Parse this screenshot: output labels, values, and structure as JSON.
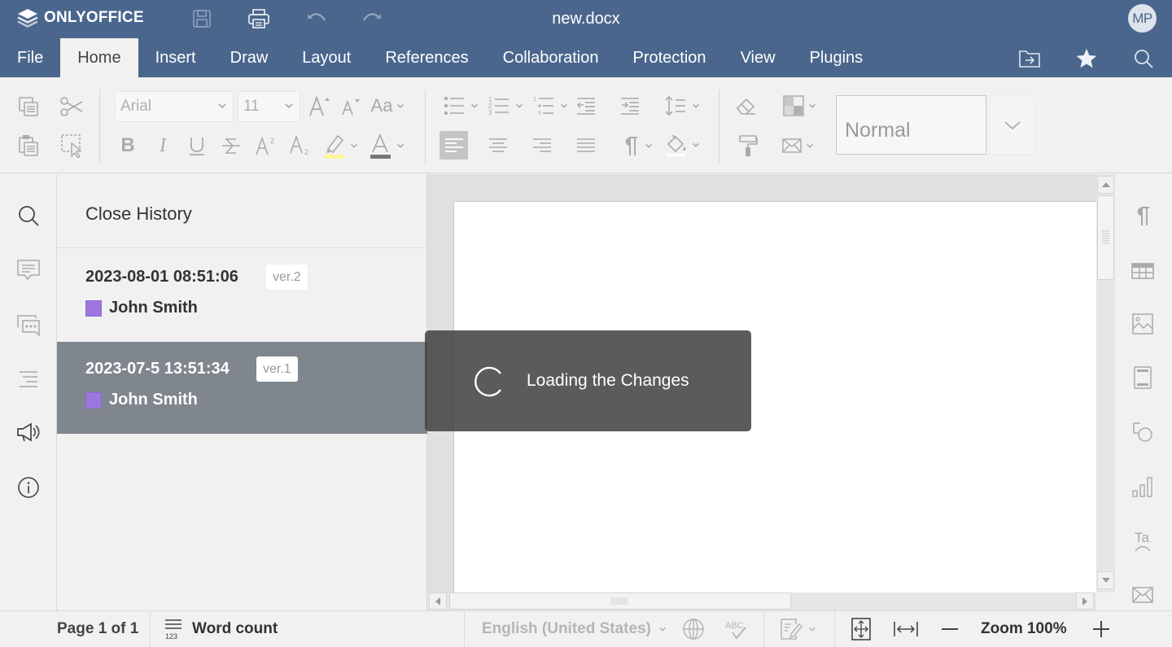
{
  "app": {
    "logo_text": "ONLYOFFICE",
    "document_title": "new.docx",
    "user_initials": "MP",
    "accent_color": "#4a668d"
  },
  "quick_access": [
    {
      "name": "save",
      "icon": "save-icon"
    },
    {
      "name": "print",
      "icon": "print-icon"
    },
    {
      "name": "undo",
      "icon": "undo-icon"
    },
    {
      "name": "redo",
      "icon": "redo-icon"
    }
  ],
  "tabs": [
    {
      "label": "File"
    },
    {
      "label": "Home",
      "active": true
    },
    {
      "label": "Insert"
    },
    {
      "label": "Draw"
    },
    {
      "label": "Layout"
    },
    {
      "label": "References"
    },
    {
      "label": "Collaboration"
    },
    {
      "label": "Protection"
    },
    {
      "label": "View"
    },
    {
      "label": "Plugins"
    }
  ],
  "header_actions": [
    {
      "icon": "open-file-location-icon"
    },
    {
      "icon": "favorite-star-icon"
    },
    {
      "icon": "search-icon"
    }
  ],
  "toolbar": {
    "font_name": "Arial",
    "font_size": "11",
    "paragraph_style": "Normal",
    "change_case_label": "Aa"
  },
  "history": {
    "close_label": "Close History",
    "versions": [
      {
        "date": "2023-08-01 08:51:06",
        "version": "ver.2",
        "user": "John Smith",
        "user_color": "#9b77de",
        "selected": false
      },
      {
        "date": "2023-07-5 13:51:34",
        "version": "ver.1",
        "user": "John Smith",
        "user_color": "#9b77de",
        "selected": true
      }
    ]
  },
  "loader": {
    "text": "Loading the Changes"
  },
  "statusbar": {
    "page_info": "Page 1 of 1",
    "word_count": "Word count",
    "language": "English (United States)",
    "zoom": "Zoom 100%"
  }
}
